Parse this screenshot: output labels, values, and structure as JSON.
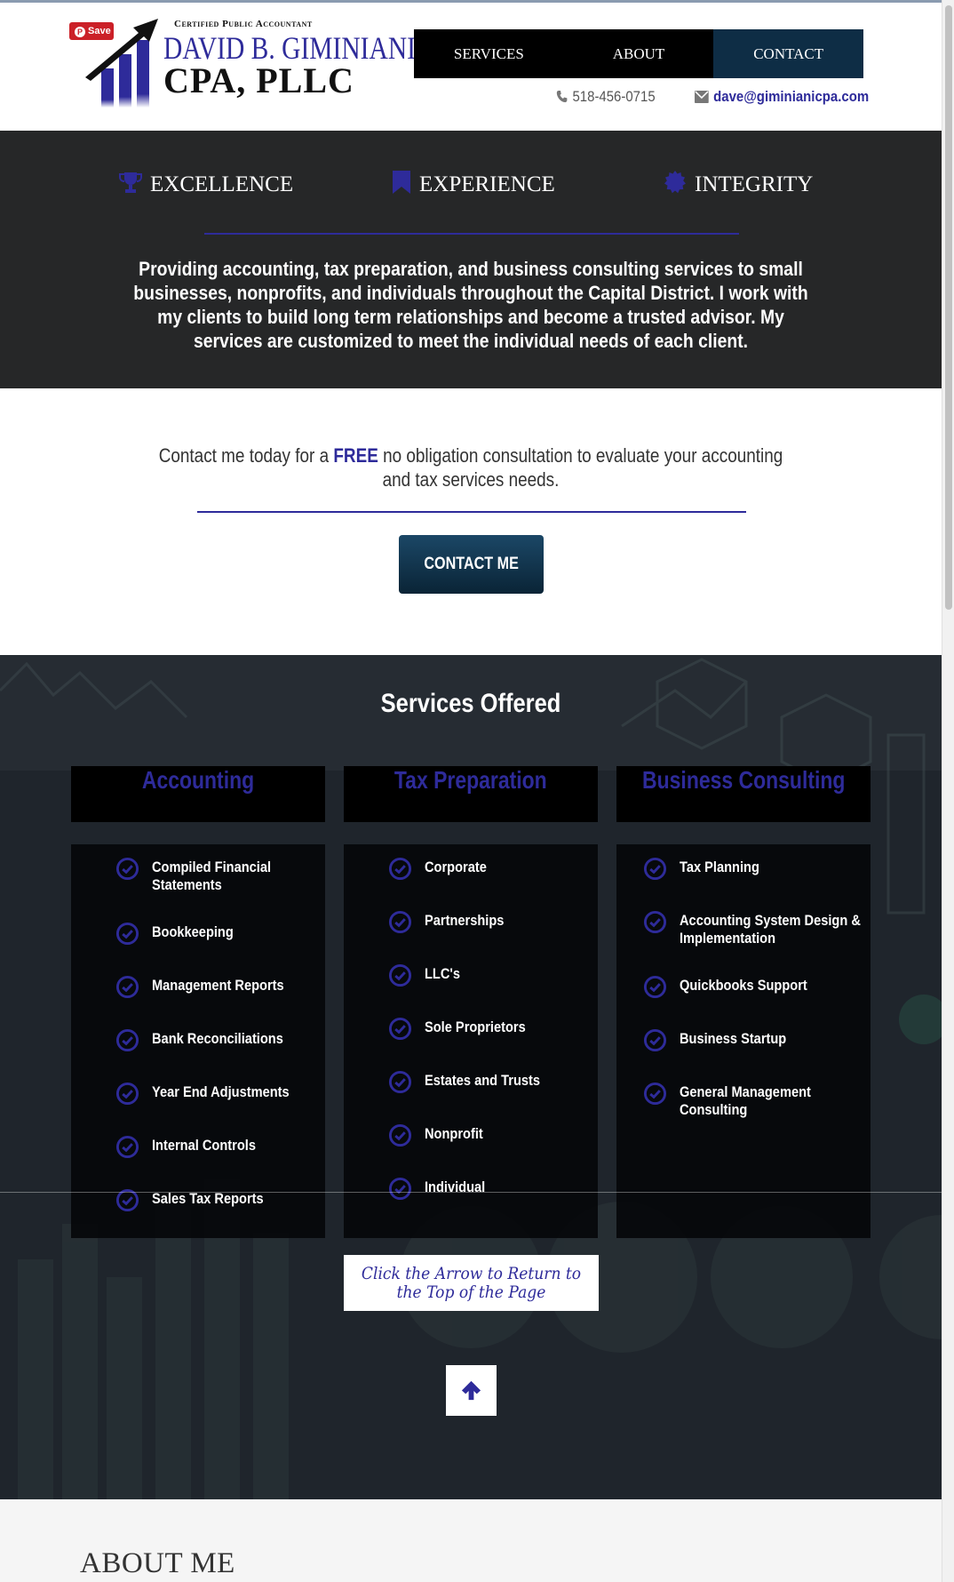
{
  "header": {
    "save_badge": "Save",
    "logo": {
      "kicker": "Certified Public Accountant",
      "name_line1": "DAVID B. GIMINIANI",
      "name_line2": "CPA, PLLC"
    },
    "nav": [
      {
        "label": "SERVICES",
        "active": false
      },
      {
        "label": "ABOUT",
        "active": false
      },
      {
        "label": "CONTACT",
        "active": true
      }
    ],
    "phone": "518-456-0715",
    "email": "dave@giminianicpa.com",
    "icons": {
      "phone": "phone-icon",
      "email": "envelope-icon"
    }
  },
  "values": {
    "items": [
      {
        "label": "EXCELLENCE",
        "icon": "trophy-icon"
      },
      {
        "label": "EXPERIENCE",
        "icon": "bookmark-icon"
      },
      {
        "label": "INTEGRITY",
        "icon": "certificate-icon"
      }
    ],
    "description": "Providing accounting, tax preparation, and business consulting services to small businesses, nonprofits, and individuals throughout the Capital District.  I work with my clients to build long term relationships and become a trusted advisor.  My services are customized to meet the individual needs of each client."
  },
  "cta": {
    "text_before": "Contact me today for a ",
    "text_free": "FREE",
    "text_after": " no obligation consultation to evaluate your accounting and tax services needs.",
    "button": "CONTACT ME"
  },
  "services": {
    "title": "Services Offered",
    "columns": [
      {
        "heading": "Accounting",
        "items": [
          "Compiled Financial Statements",
          "Bookkeeping",
          "Management Reports",
          "Bank Reconciliations",
          "Year End Adjustments",
          "Internal Controls",
          "Sales Tax Reports"
        ]
      },
      {
        "heading": "Tax Preparation",
        "items": [
          "Corporate",
          "Partnerships",
          "LLC's",
          "Sole Proprietors",
          "Estates and Trusts",
          "Nonprofit",
          "Individual"
        ]
      },
      {
        "heading": "Business Consulting",
        "items": [
          "Tax Planning",
          "Accounting System Design & Implementation",
          "Quickbooks Support",
          "Business Startup",
          "General Management Consulting"
        ]
      }
    ],
    "return_note": "Click the Arrow to Return to the Top of the Page",
    "arrow_icon": "arrow-up-icon"
  },
  "about": {
    "title": "ABOUT ME"
  },
  "colors": {
    "brand_blue": "#2e2b9a",
    "nav_active": "#0e2d45",
    "dark_band": "#262728"
  }
}
